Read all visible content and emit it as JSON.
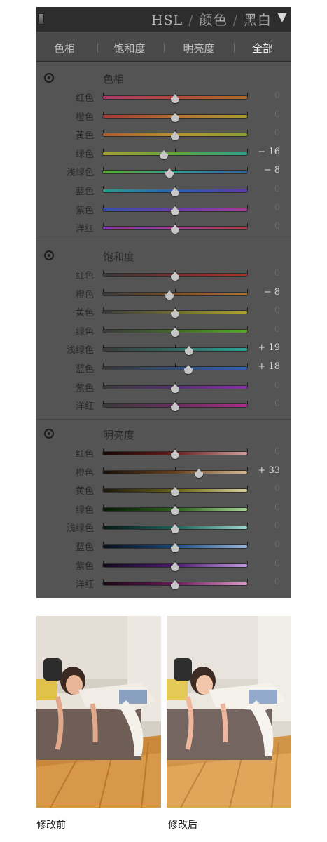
{
  "header": {
    "title_hsl": "HSL",
    "title_color": "颜色",
    "title_bw": "黑白",
    "separator": "/"
  },
  "tabs": [
    {
      "label": "色相",
      "selected": false
    },
    {
      "label": "饱和度",
      "selected": false
    },
    {
      "label": "明亮度",
      "selected": false
    },
    {
      "label": "全部",
      "selected": true
    }
  ],
  "sections": [
    {
      "title": "色相",
      "rows": [
        {
          "label": "红色",
          "value": "0",
          "amount": 0,
          "track": [
            "#a63a6a",
            "#b34a38",
            "#a86c2d"
          ]
        },
        {
          "label": "橙色",
          "value": "0",
          "amount": 0,
          "track": [
            "#a63a3a",
            "#b8702f",
            "#a89a34"
          ]
        },
        {
          "label": "黄色",
          "value": "0",
          "amount": 0,
          "track": [
            "#b25a2a",
            "#b8922e",
            "#8aa032"
          ]
        },
        {
          "label": "绿色",
          "value": "− 16",
          "amount": -16,
          "track": [
            "#a8a034",
            "#5ea63a",
            "#2fa08a"
          ]
        },
        {
          "label": "浅绿色",
          "value": "− 8",
          "amount": -8,
          "track": [
            "#5ea63a",
            "#2fa08a",
            "#2f62a8"
          ]
        },
        {
          "label": "蓝色",
          "value": "0",
          "amount": 0,
          "track": [
            "#2f9c8c",
            "#2f5eaa",
            "#5a3aa8"
          ]
        },
        {
          "label": "紫色",
          "value": "0",
          "amount": 0,
          "track": [
            "#2f52a8",
            "#6a3aa8",
            "#a23a96"
          ]
        },
        {
          "label": "洋红",
          "value": "0",
          "amount": 0,
          "track": [
            "#7a3aa8",
            "#a83a8a",
            "#b03a48"
          ]
        }
      ]
    },
    {
      "title": "饱和度",
      "rows": [
        {
          "label": "红色",
          "value": "0",
          "amount": 0,
          "track": [
            "#3a3a3a",
            "#6e3232",
            "#b02e2e"
          ]
        },
        {
          "label": "橙色",
          "value": "− 8",
          "amount": -8,
          "track": [
            "#3a3a3a",
            "#74502e",
            "#b8702a"
          ]
        },
        {
          "label": "黄色",
          "value": "0",
          "amount": 0,
          "track": [
            "#3a3a3a",
            "#6e6a30",
            "#b0a42e"
          ]
        },
        {
          "label": "绿色",
          "value": "0",
          "amount": 0,
          "track": [
            "#3a3a3a",
            "#44682e",
            "#5aa62e"
          ]
        },
        {
          "label": "浅绿色",
          "value": "+ 19",
          "amount": 19,
          "track": [
            "#3a3a3a",
            "#2e6860",
            "#2ea094"
          ]
        },
        {
          "label": "蓝色",
          "value": "+ 18",
          "amount": 18,
          "track": [
            "#3a3a3a",
            "#2e4a74",
            "#2e62b0"
          ]
        },
        {
          "label": "紫色",
          "value": "0",
          "amount": 0,
          "track": [
            "#3a3a3a",
            "#553072",
            "#8a2eae"
          ]
        },
        {
          "label": "洋红",
          "value": "0",
          "amount": 0,
          "track": [
            "#3a3a3a",
            "#6a2e5e",
            "#ae2e8c"
          ]
        }
      ]
    },
    {
      "title": "明亮度",
      "rows": [
        {
          "label": "红色",
          "value": "0",
          "amount": 0,
          "track": [
            "#1a0808",
            "#6a1e1e",
            "#d0a0a0"
          ]
        },
        {
          "label": "橙色",
          "value": "+ 33",
          "amount": 33,
          "track": [
            "#1a1008",
            "#6a4018",
            "#d8b890"
          ]
        },
        {
          "label": "黄色",
          "value": "0",
          "amount": 0,
          "track": [
            "#1a1808",
            "#6a6218",
            "#d8d098"
          ]
        },
        {
          "label": "绿色",
          "value": "0",
          "amount": 0,
          "track": [
            "#081a08",
            "#2a6218",
            "#a8d898"
          ]
        },
        {
          "label": "浅绿色",
          "value": "0",
          "amount": 0,
          "track": [
            "#081a18",
            "#186256",
            "#98d8cc"
          ]
        },
        {
          "label": "蓝色",
          "value": "0",
          "amount": 0,
          "track": [
            "#08101a",
            "#184a80",
            "#98b8e0"
          ]
        },
        {
          "label": "紫色",
          "value": "0",
          "amount": 0,
          "track": [
            "#10081a",
            "#4a1870",
            "#c098e0"
          ]
        },
        {
          "label": "洋红",
          "value": "0",
          "amount": 0,
          "track": [
            "#1a0814",
            "#6a1858",
            "#e098cc"
          ]
        }
      ]
    }
  ],
  "photos": {
    "before_caption": "修改前",
    "after_caption": "修改后"
  }
}
